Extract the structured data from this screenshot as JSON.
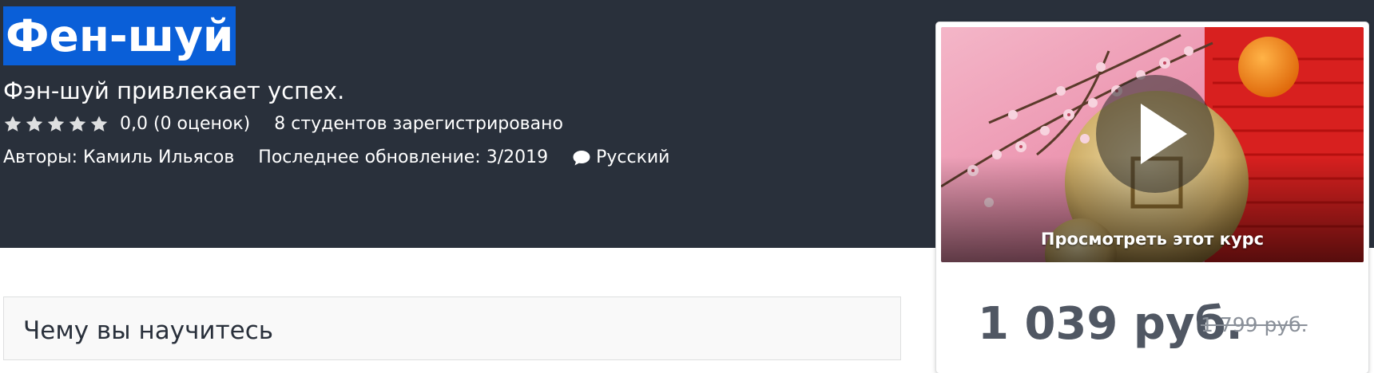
{
  "course": {
    "title": "Фен-шуй",
    "subtitle": "Фэн-шуй привлекает успех.",
    "rating_text": "0,0 (0 оценок)",
    "students_text": "8 студентов зарегистрировано",
    "authors_text": "Авторы: Камиль Ильясов",
    "updated_text": "Последнее обновление: 3/2019",
    "language": "Русский",
    "stars": 0
  },
  "preview": {
    "caption": "Просмотреть этот курс"
  },
  "pricing": {
    "price": "1 039 руб.",
    "old_price": "1 799 руб."
  },
  "learn": {
    "title": "Чему вы научитесь"
  },
  "colors": {
    "hero_bg": "#29303b",
    "title_highlight": "#0a5fd8",
    "price_text": "#505763"
  },
  "icons": [
    "star-icon",
    "chat-bubble-icon",
    "play-icon"
  ]
}
